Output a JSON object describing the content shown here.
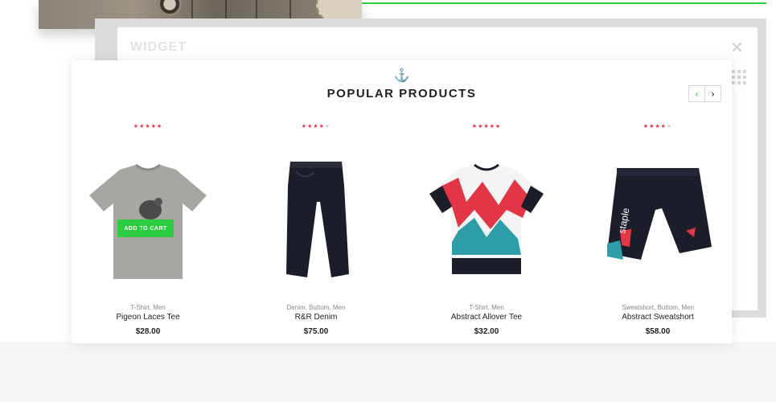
{
  "widget": {
    "title": "WIDGET",
    "close_glyph": "✕"
  },
  "section": {
    "title": "POPULAR PRODUCTS",
    "icon": "anchor-icon",
    "icon_glyph": "⚓"
  },
  "carousel": {
    "prev_glyph": "‹",
    "next_glyph": "›"
  },
  "colors": {
    "accent": "#2ecc40",
    "star": "#e8344a",
    "star_off": "#c9c9c9"
  },
  "products": [
    {
      "stars": 5,
      "category": "T-Shirt, Men",
      "name": "Pigeon Laces Tee",
      "price": "$28.00",
      "cart_label": "ADD TO CART"
    },
    {
      "stars": 4,
      "category": "Denim, Buttom, Men",
      "name": "R&R Denim",
      "price": "$75.00"
    },
    {
      "stars": 5,
      "category": "T-Shirt, Men",
      "name": "Abstract Allover Tee",
      "price": "$32.00"
    },
    {
      "stars": 4,
      "category": "Sweatshort, Buttom, Men",
      "name": "Abstract Sweatshort",
      "price": "$58.00"
    }
  ]
}
